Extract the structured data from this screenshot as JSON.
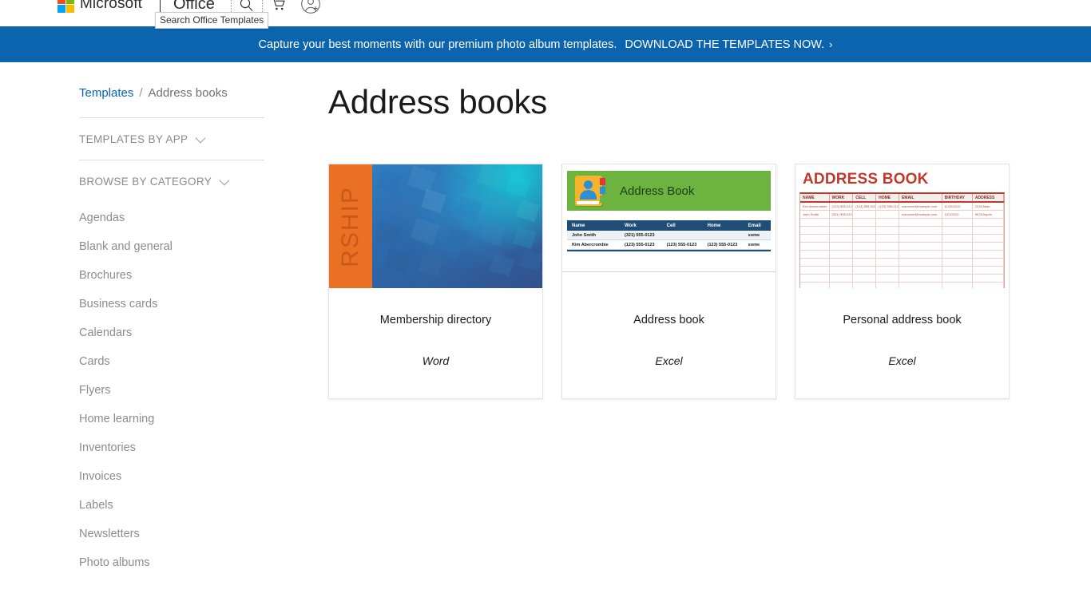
{
  "header": {
    "logo_name": "microsoft-logo",
    "brand": "Microsoft",
    "product": "Office",
    "icons": {
      "search": "search-icon",
      "cart": "shopping-cart-icon",
      "account": "sign-in-person-icon"
    }
  },
  "tooltip": {
    "text": "Search Office Templates"
  },
  "promo": {
    "message": "Capture your best moments with our premium photo album templates.",
    "cta": "DOWNLOAD THE TEMPLATES NOW.",
    "chevron": "›",
    "background_color": "#0c64ae"
  },
  "breadcrumb": {
    "root": "Templates",
    "separator": "/",
    "current": "Address books"
  },
  "sidebar": {
    "sections": [
      {
        "label": "TEMPLATES BY APP"
      },
      {
        "label": "BROWSE BY CATEGORY"
      }
    ],
    "categories": [
      {
        "label": "Agendas"
      },
      {
        "label": "Blank and general"
      },
      {
        "label": "Brochures"
      },
      {
        "label": "Business cards"
      },
      {
        "label": "Calendars"
      },
      {
        "label": "Cards"
      },
      {
        "label": "Flyers"
      },
      {
        "label": "Home learning"
      },
      {
        "label": "Inventories"
      },
      {
        "label": "Invoices"
      },
      {
        "label": "Labels"
      },
      {
        "label": "Newsletters"
      },
      {
        "label": "Photo albums"
      }
    ]
  },
  "main": {
    "title": "Address books",
    "cards": [
      {
        "title": "Membership directory",
        "app": "Word",
        "thumb_text": "RSHIP"
      },
      {
        "title": "Address book",
        "app": "Excel",
        "thumb_title": "Address Book"
      },
      {
        "title": "Personal address book",
        "app": "Excel",
        "thumb_title": "ADDRESS BOOK"
      }
    ]
  },
  "thumb2": {
    "header_title": "Address Book",
    "columns": [
      "Name",
      "Work",
      "Cell",
      "Home",
      "Email"
    ],
    "rows": [
      [
        "John Smith",
        "(321) 555-0123",
        "",
        "",
        "some"
      ],
      [
        "Kim Abercrombie",
        "(123) 555-0123",
        "(123) 555-0123",
        "(123) 555-0123",
        "some"
      ]
    ]
  },
  "thumb3": {
    "header_title": "ADDRESS BOOK",
    "columns": [
      "NAME",
      "WORK",
      "CELL",
      "HOME",
      "EMAIL",
      "BIRTHDAY",
      "ADDRESS"
    ],
    "rows": [
      [
        "Kim Abercrombie",
        "(123) 555-0123",
        "(123) 555-0123",
        "(123) 555-0123",
        "someone@example.com",
        "11/30/2010",
        "1234 Main"
      ],
      [
        "John Smith",
        "(321) 555-0123",
        "",
        "",
        "someone@example.com",
        "12/1/2010",
        "5678 Aspen"
      ]
    ]
  },
  "colors": {
    "banner_blue": "#0c64ae",
    "link_blue": "#0067b8",
    "orange": "#ea7023",
    "green": "#6cb33f",
    "excel_navy": "#1f4e79",
    "red": "#c0392b"
  }
}
